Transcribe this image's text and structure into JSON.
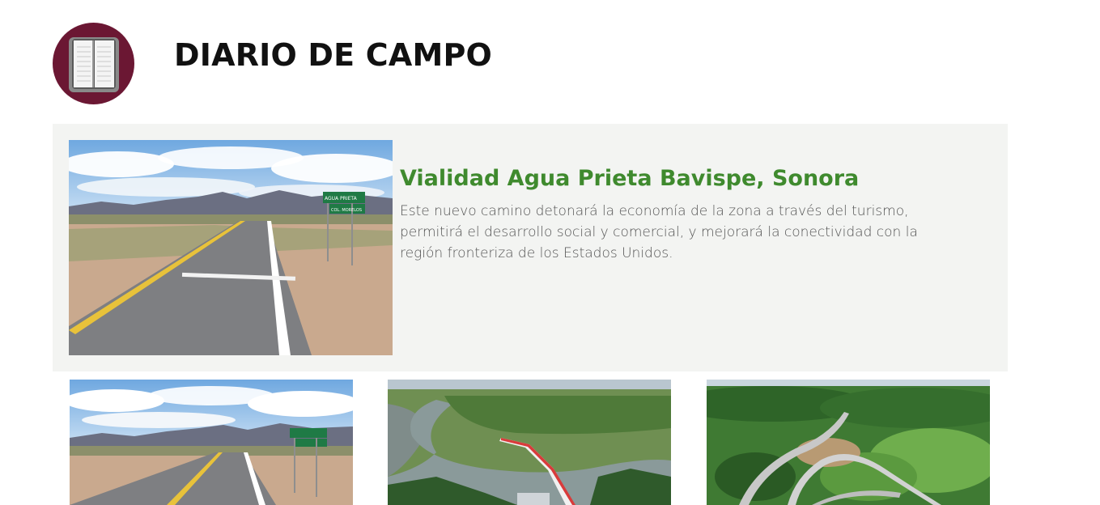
{
  "header": {
    "title": "DIARIO DE CAMPO",
    "logo_icon": "open-book-icon",
    "logo_color": "#6b1733"
  },
  "featured": {
    "title": "Vialidad Agua Prieta Bavispe, Sonora",
    "description": "Este nuevo camino detonará la economía de la zona a través del turismo, permitirá el desarrollo social y comercial, y mejorará la conectividad con la región fronteriza de los Estados Unidos.",
    "sign_line_1": "AGUA PRIETA",
    "sign_line_2": "COL. MORELOS",
    "title_color": "#3f8a2e",
    "panel_color": "#f3f4f2"
  },
  "gallery": {
    "thumbs": [
      {
        "scene": "desert-highway-photo"
      },
      {
        "scene": "river-bridge-aerial-photo"
      },
      {
        "scene": "green-hills-highway-aerial-photo"
      }
    ]
  }
}
